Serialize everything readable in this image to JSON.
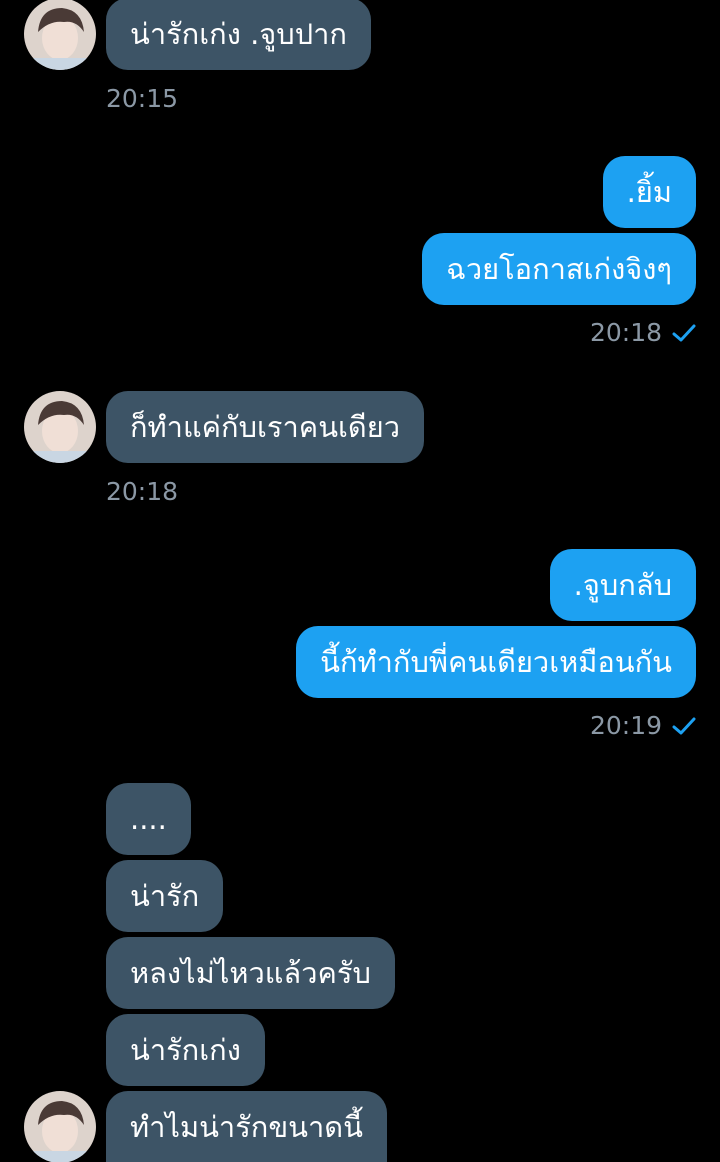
{
  "conversation": {
    "group1": {
      "messages": [
        "น่ารักเก่ง .จูบปาก"
      ],
      "time": "20:15"
    },
    "group2": {
      "messages": [
        ".ยิ้ม",
        "ฉวยโอกาสเก่งจิงๆ"
      ],
      "time": "20:18"
    },
    "group3": {
      "messages": [
        "ก็ทำแค่กับเราคนเดียว"
      ],
      "time": "20:18"
    },
    "group4": {
      "messages": [
        ".จูบกลับ",
        "นี้ก้ทำกับพี่คนเดียวเหมือนกัน"
      ],
      "time": "20:19"
    },
    "group5": {
      "messages": [
        "....",
        "น่ารัก",
        "หลงไม่ไหวแล้วครับ",
        "น่ารักเก่ง",
        "ทำไมน่ารักขนาดนี้"
      ]
    }
  },
  "icons": {
    "avatar": "contact-avatar",
    "sent_check": "check-icon"
  },
  "colors": {
    "background": "#000000",
    "incoming_bubble": "#3d5466",
    "outgoing_bubble": "#1da1f2",
    "timestamp": "#8b98a5",
    "check": "#1da1f2"
  }
}
